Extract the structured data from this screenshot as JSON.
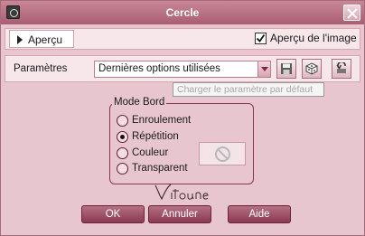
{
  "window": {
    "title": "Cercle"
  },
  "icons": {
    "app": "camera-icon",
    "close": "close-icon",
    "save": "save-icon",
    "random": "dice-icon",
    "reset": "reset-icon",
    "no_color": "no-color-icon"
  },
  "preview": {
    "toggle_label": "Aperçu",
    "checkbox_label": "Aperçu de l'image",
    "checked": true
  },
  "params": {
    "label": "Paramètres",
    "selected": "Dernières options utilisées",
    "tooltip": "Charger le paramètre par défaut"
  },
  "mode_bord": {
    "title": "Mode Bord",
    "options": [
      {
        "label": "Enroulement",
        "checked": false
      },
      {
        "label": "Répétition",
        "checked": true
      },
      {
        "label": "Couleur",
        "checked": false
      },
      {
        "label": "Transparent",
        "checked": false
      }
    ]
  },
  "signature": "Vitoune",
  "buttons": {
    "ok": "OK",
    "cancel": "Annuler",
    "help": "Aide"
  },
  "colors": {
    "accent": "#a95e74",
    "background": "#e8c6cf",
    "button": "#8a3a53"
  }
}
